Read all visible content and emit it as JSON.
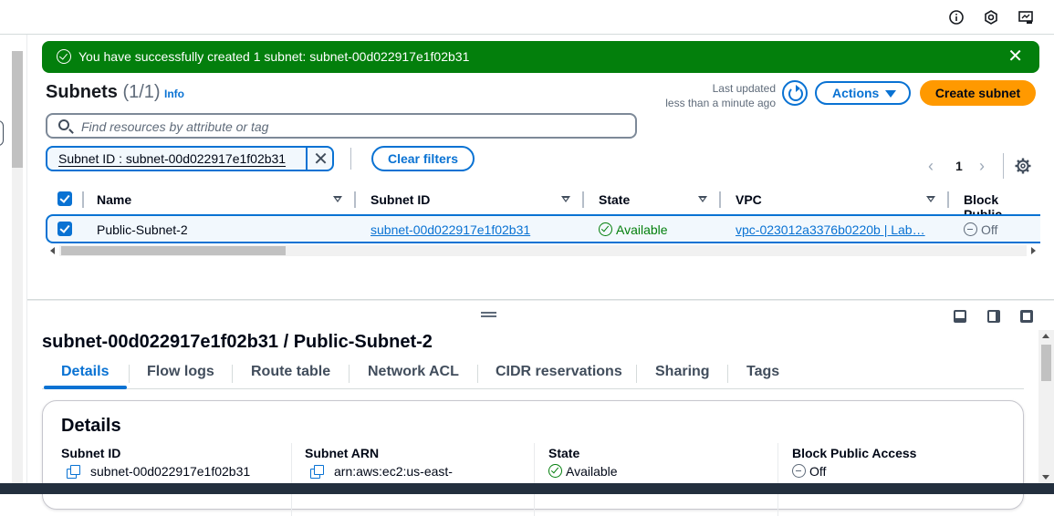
{
  "flash": {
    "message": "You have successfully created 1 subnet: subnet-00d022917e1f02b31",
    "close": "✕"
  },
  "header": {
    "title": "Subnets",
    "count": "(1/1)",
    "info": "Info",
    "last_updated_label": "Last updated",
    "last_updated_value": "less than a minute ago",
    "actions_label": "Actions",
    "create_label": "Create subnet"
  },
  "filter": {
    "placeholder": "Find resources by attribute or tag",
    "token": "Subnet ID : subnet-00d022917e1f02b31",
    "token_remove": "✕",
    "clear_label": "Clear filters"
  },
  "pagination": {
    "prev": "‹",
    "page": "1",
    "next": "›"
  },
  "table": {
    "columns": [
      "Name",
      "Subnet ID",
      "State",
      "VPC",
      "Block Public"
    ],
    "rows": [
      {
        "name": "Public-Subnet-2",
        "subnet_id": "subnet-00d022917e1f02b31",
        "state": "Available",
        "vpc": "vpc-023012a3376b0220b | Lab…",
        "block_public": "Off"
      }
    ]
  },
  "detail": {
    "title": "subnet-00d022917e1f02b31 / Public-Subnet-2",
    "tabs": [
      "Details",
      "Flow logs",
      "Route table",
      "Network ACL",
      "CIDR reservations",
      "Sharing",
      "Tags"
    ],
    "active_tab": "Details",
    "card_heading": "Details",
    "fields": [
      {
        "label": "Subnet ID",
        "value": "subnet-00d022917e1f02b31"
      },
      {
        "label": "Subnet ARN",
        "value": "arn:aws:ec2:us-east-"
      },
      {
        "label": "State",
        "value": "Available"
      },
      {
        "label": "Block Public Access",
        "value": "Off"
      }
    ]
  },
  "colors": {
    "success": "#037f0c",
    "link": "#0972d3",
    "primary_button": "#ff9900"
  }
}
